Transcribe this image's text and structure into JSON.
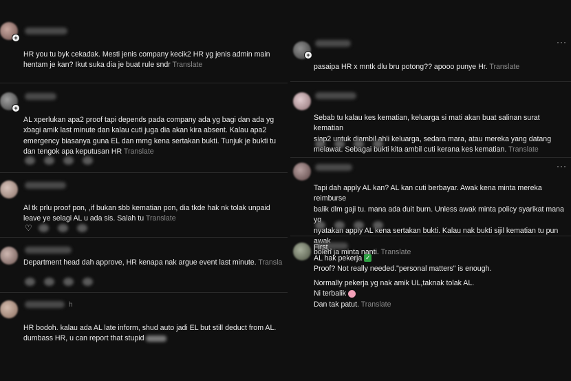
{
  "left": {
    "posts": [
      {
        "text": "HR you tu byk cekadak. Mesti jenis company kecik2 HR yg jenis admin main\nhentam je kan? Ikut suka dia je buat rule sndr",
        "translate": "Translate"
      },
      {
        "text": "AL xperlukan apa2 proof tapi depends pada company ada yg bagi dan ada yg\nxbagi amik last minute dan kalau cuti juga dia akan kira absent. Kalau apa2\nemergency biasanya guna EL dan mmg kena sertakan bukti. Tunjuk je bukti tu\ndan tengok apa keputusan HR",
        "translate": "Translate"
      },
      {
        "text": "Al tk prlu proof pon, ,if bukan sbb kematian pon, dia tkde hak nk tolak unpaid\nleave ye selagi AL u ada sis. Salah tu",
        "translate": "Translate"
      },
      {
        "text": "Department head dah approve, HR kenapa nak argue event last minute.",
        "translate": "Transla"
      },
      {
        "username_suffix": "h",
        "text": "HR bodoh. kalau ada AL late inform, shud auto jadi EL but still deduct from AL.\ndumbass HR, u can report that stupid"
      }
    ]
  },
  "right": {
    "posts": [
      {
        "text": "pasaipa HR x mntk dlu bru potong?? apooo punye Hr.",
        "translate": "Translate"
      },
      {
        "text": "Sebab tu kalau kes kematian, keluarga si mati akan buat salinan surat kematian\nsiap2 untuk diambil ahli keluarga, sedara mara, atau mereka yang datang\nmelawat. Sebagai bukti kita ambil cuti kerana kes kematian.",
        "translate": "Translate"
      },
      {
        "text": "Tapi dah apply AL kan? AL kan cuti berbayar. Awak kena minta mereka reimburse\nbalik dlm gaji tu. mana ada duit burn. Unless awak minta policy syarikat mana yg\nnyatakan apply AL kena sertakan bukti. Kalau nak bukti sijil kematian tu pun awak\nboleh ja minta nanti.",
        "translate": "Translate"
      },
      {
        "line1": "First ,",
        "line2": "AL hak pekerja",
        "line3": "Proof? Not really needed.\"personal matters\" is enough.",
        "line4": "Normally pekerja yg nak amik UL,taknak tolak AL.",
        "line5": "Ni terbalik",
        "line6": "Dan tak patut.",
        "translate": "Translate"
      }
    ],
    "more_label": "···"
  },
  "colors": {
    "background": "#101010",
    "text": "#ececec",
    "muted": "#8a8a8a",
    "divider": "#2a2a2a",
    "check": "#2ea043"
  },
  "icons": {
    "follow": "plus-icon",
    "like": "heart-icon",
    "more": "more-icon",
    "check": "check-mark-icon",
    "emoji": "smiling-emoji-icon"
  }
}
